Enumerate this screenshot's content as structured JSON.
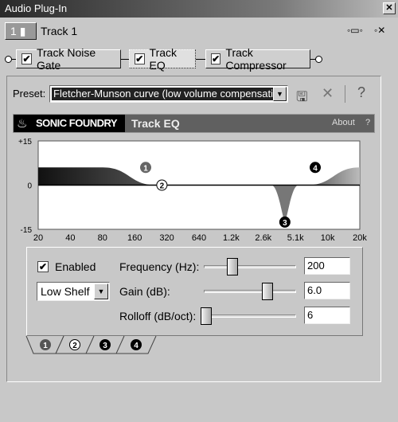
{
  "window": {
    "title": "Audio Plug-In",
    "close_label": "✕"
  },
  "track": {
    "number": "1",
    "name": "Track 1"
  },
  "chain": [
    {
      "label": "Track Noise Gate",
      "checked": true
    },
    {
      "label": "Track EQ",
      "checked": true,
      "selected": true
    },
    {
      "label": "Track Compressor",
      "checked": true
    }
  ],
  "preset": {
    "label": "Preset:",
    "value": "Fletcher-Munson curve (low volume compensation)"
  },
  "brand": {
    "logo": "SONIC FOUNDRY",
    "plugin": "Track EQ",
    "about": "About",
    "help": "?"
  },
  "chart_data": {
    "type": "line",
    "y_ticks": [
      "+15",
      "0",
      "-15"
    ],
    "ylim": [
      -15,
      15
    ],
    "x_ticks": [
      "20",
      "40",
      "80",
      "160",
      "320",
      "640",
      "1.2k",
      "2.6k",
      "5.1k",
      "10k",
      "20k"
    ],
    "xlim_hz": [
      20,
      20000
    ],
    "x_scale": "log",
    "bands": [
      {
        "label": "1",
        "type": "Low Shelf",
        "freq_hz": 200,
        "gain_db": 6.0
      },
      {
        "label": "2",
        "freq_hz": 300,
        "gain_db": 0
      },
      {
        "label": "3",
        "freq_hz": 4000,
        "gain_db": -12
      },
      {
        "label": "4",
        "type": "High Shelf",
        "freq_hz": 8000,
        "gain_db": 6
      }
    ]
  },
  "band_editor": {
    "enabled_label": "Enabled",
    "enabled": true,
    "filter_type": "Low Shelf",
    "frequency": {
      "label": "Frequency (Hz):",
      "value": "200",
      "fraction": 0.3
    },
    "gain": {
      "label": "Gain (dB):",
      "value": "6.0",
      "fraction": 0.7
    },
    "rolloff": {
      "label": "Rolloff (dB/oct):",
      "value": "6",
      "fraction": 0.0
    }
  },
  "tabs": [
    "1",
    "2",
    "3",
    "4"
  ],
  "active_tab": 0
}
